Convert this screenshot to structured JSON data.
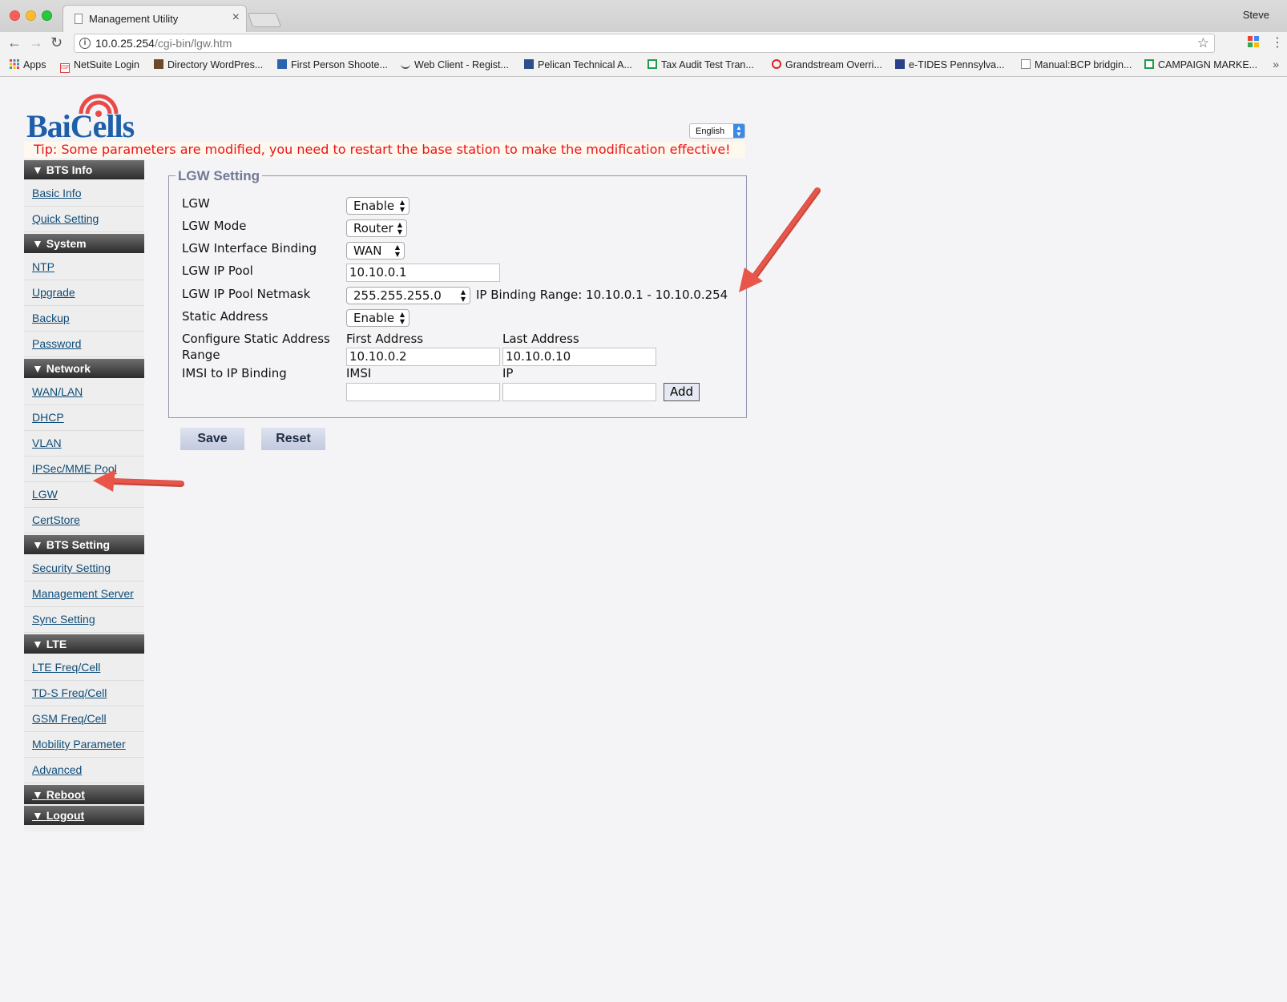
{
  "browser": {
    "tab_title": "Management Utility",
    "profile_name": "Steve",
    "url_host": "10.0.25.254",
    "url_path": "/cgi-bin/lgw.htm",
    "bookmarks": [
      "Apps",
      "NetSuite Login",
      "Directory WordPres...",
      "First Person Shoote...",
      "Web Client - Regist...",
      "Pelican Technical A...",
      "Tax Audit Test Tran...",
      "Grandstream Overri...",
      "e-TIDES Pennsylva...",
      "Manual:BCP bridgin...",
      "CAMPAIGN MARKE..."
    ]
  },
  "page": {
    "logo_text": "BaiCells",
    "language": "English",
    "tip": "Tip: Some parameters are modified, you need to restart the base station to make the modification effective!"
  },
  "sidebar": {
    "sections": [
      {
        "title": "BTS Info",
        "items": [
          "Basic Info",
          "Quick Setting"
        ]
      },
      {
        "title": "System",
        "items": [
          "NTP",
          "Upgrade",
          "Backup",
          "Password"
        ]
      },
      {
        "title": "Network",
        "items": [
          "WAN/LAN",
          "DHCP",
          "VLAN",
          "IPSec/MME Pool",
          "LGW",
          "CertStore"
        ]
      },
      {
        "title": "BTS Setting",
        "items": [
          "Security Setting",
          "Management Server",
          "Sync Setting"
        ]
      },
      {
        "title": "LTE",
        "items": [
          "LTE Freq/Cell",
          "TD-S Freq/Cell",
          "GSM Freq/Cell",
          "Mobility Parameter",
          "Advanced"
        ]
      }
    ],
    "reboot": "Reboot",
    "logout": "Logout"
  },
  "lgw_form": {
    "legend": "LGW Setting",
    "lgw_label": "LGW",
    "lgw_value": "Enable",
    "mode_label": "LGW Mode",
    "mode_value": "Router",
    "binding_label": "LGW Interface Binding",
    "binding_value": "WAN",
    "pool_label": "LGW IP Pool",
    "pool_value": "10.10.0.1",
    "netmask_label": "LGW IP Pool Netmask",
    "netmask_value": "255.255.255.0",
    "binding_range": "IP Binding Range: 10.10.0.1 - 10.10.0.254",
    "static_label": "Static Address",
    "static_value": "Enable",
    "range_label_1": "Configure Static Address",
    "range_label_2": "Range",
    "first_address_label": "First Address",
    "last_address_label": "Last Address",
    "first_address_value": "10.10.0.2",
    "last_address_value": "10.10.0.10",
    "imsi_binding_label": "IMSI to IP Binding",
    "imsi_label": "IMSI",
    "ip_label": "IP",
    "add_label": "Add"
  },
  "actions": {
    "save": "Save",
    "reset": "Reset"
  },
  "colors": {
    "tip_red": "#e8141a",
    "annotation_arrow": "#e8564a",
    "sidebar_link": "#0f4c78"
  }
}
